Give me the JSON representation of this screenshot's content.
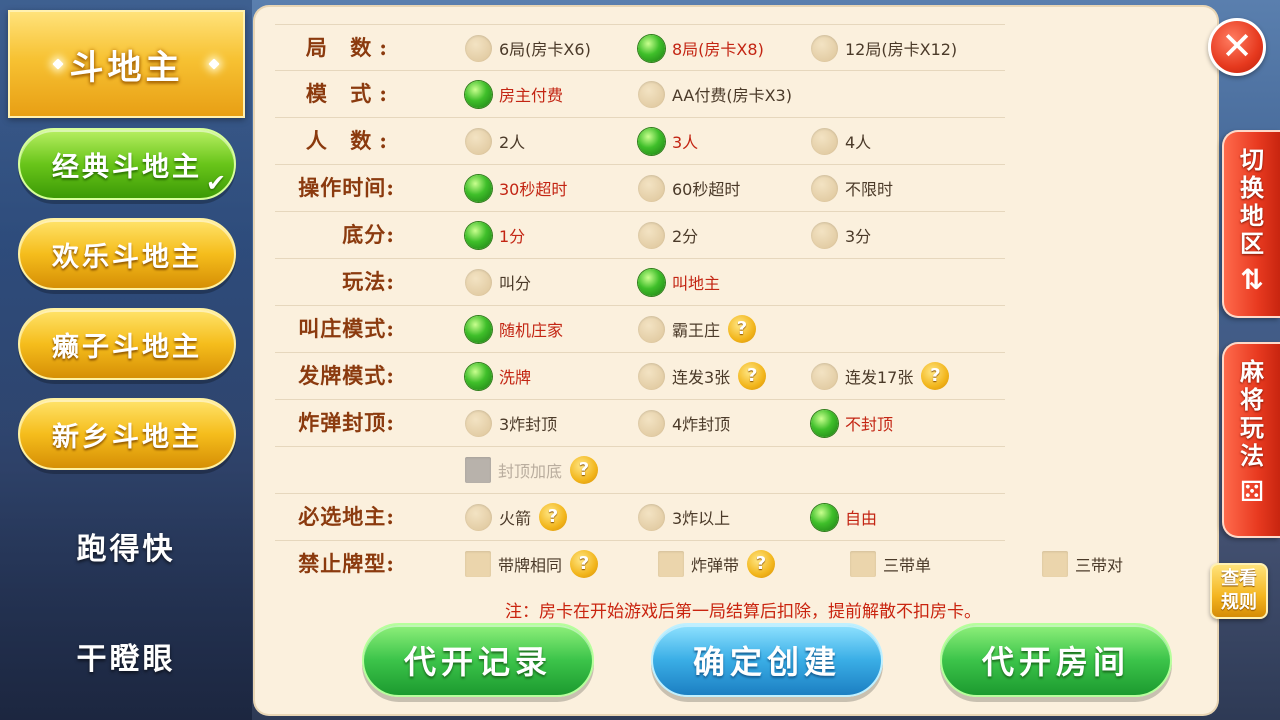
{
  "sidebar": {
    "header": "斗地主",
    "variants": [
      {
        "label": "经典斗地主",
        "selected": true
      },
      {
        "label": "欢乐斗地主",
        "selected": false
      },
      {
        "label": "癞子斗地主",
        "selected": false
      },
      {
        "label": "新乡斗地主",
        "selected": false
      }
    ],
    "games": [
      "跑得快",
      "干瞪眼"
    ]
  },
  "rows": {
    "rounds": {
      "label": "局  数:",
      "options": [
        "6局(房卡X6)",
        "8局(房卡X8)",
        "12局(房卡X12)"
      ]
    },
    "mode": {
      "label": "模  式:",
      "options": [
        "房主付费",
        "AA付费(房卡X3)"
      ]
    },
    "players": {
      "label": "人  数:",
      "options": [
        "2人",
        "3人",
        "4人"
      ]
    },
    "time": {
      "label": "操作时间:",
      "options": [
        "30秒超时",
        "60秒超时",
        "不限时"
      ]
    },
    "base": {
      "label": "底分:",
      "options": [
        "1分",
        "2分",
        "3分"
      ]
    },
    "play": {
      "label": "玩法:",
      "options": [
        "叫分",
        "叫地主"
      ]
    },
    "banker": {
      "label": "叫庄模式:",
      "options": [
        "随机庄家",
        "霸王庄"
      ]
    },
    "deal": {
      "label": "发牌模式:",
      "options": [
        "洗牌",
        "连发3张",
        "连发17张"
      ]
    },
    "bomb": {
      "label": "炸弹封顶:",
      "options": [
        "3炸封顶",
        "4炸封顶",
        "不封顶"
      ]
    },
    "cap_extra": {
      "options": [
        "封顶加底"
      ]
    },
    "landlord": {
      "label": "必选地主:",
      "options": [
        "火箭",
        "3炸以上",
        "自由"
      ]
    },
    "banned": {
      "label": "禁止牌型:",
      "options": [
        "带牌相同",
        "炸弹带",
        "三带单",
        "三带对"
      ]
    }
  },
  "note": "注：房卡在开始游戏后第一局结算后扣除，提前解散不扣房卡。",
  "buttons": {
    "records": "代开记录",
    "create": "确定创建",
    "proxy_room": "代开房间"
  },
  "right_tabs": {
    "switch_region": "切换地区",
    "mahjong": "麻将玩法",
    "rules": "查看规则"
  },
  "icons": {
    "close": "close-icon",
    "help": "question-icon",
    "swap": "swap-arrows-icon",
    "dice": "dice-icon"
  },
  "colors": {
    "selected_text": "#c32513",
    "label": "#8b3a0e",
    "panel_bg": "#fbf0dd",
    "radio_on": "#3fbf2a"
  }
}
